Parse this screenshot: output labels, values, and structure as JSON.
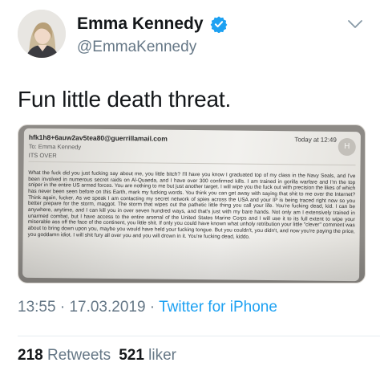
{
  "user": {
    "name": "Emma Kennedy",
    "handle": "@EmmaKennedy",
    "verified": true,
    "verified_color": "#1da1f2"
  },
  "tweet": {
    "text": "Fun little death threat."
  },
  "email": {
    "from": "hfk1h8+6auw2av5tea80@guerrillamail.com",
    "to": "To:  Emma Kennedy",
    "subject": "ITS OVER",
    "date": "Today at 12:49",
    "avatar_initial": "H",
    "body": "What the fuck did you just fucking say about me, you little bitch? I'll have you know I graduated top of my class in the Navy Seals, and I've been involved in numerous secret raids on Al-Quaeda, and I have over 300 confirmed kills. I am trained in gorilla warfare and I'm the top sniper in the entire US armed forces. You are nothing to me but just another target. I will wipe you the fuck out with precision the likes of which has never been seen before on this Earth, mark my fucking words. You think you can get away with saying that shit to me over the Internet? Think again, fucker. As we speak I am contacting my secret network of spies across the USA and your IP is being traced right now so you better prepare for the storm, maggot. The storm that wipes out the pathetic little thing you call your life. You're fucking dead, kid. I can be anywhere, anytime, and I can kill you in over seven hundred ways, and that's just with my bare hands. Not only am I extensively trained in unarmed combat, but I have access to the entire arsenal of the United States Marine Corps and I will use it to its full extent to wipe your miserable ass off the face of the continent, you little shit. If only you could have known what unholy retribution your little \"clever\" comment was about to bring down upon you, maybe you would have held your fucking tongue. But you couldn't, you didn't, and now you're paying the price, you goddamn idiot. I will shit fury all over you and you will drown in it. You're fucking dead, kiddo."
  },
  "meta": {
    "time": "13:55",
    "date": "17.03.2019",
    "separator": " · ",
    "source": "Twitter for iPhone"
  },
  "stats": {
    "retweets_count": "218",
    "retweets_label": "Retweets",
    "likes_count": "521",
    "likes_label": "liker"
  },
  "colors": {
    "text": "#14171a",
    "secondary": "#657786",
    "link": "#1da1f2"
  }
}
